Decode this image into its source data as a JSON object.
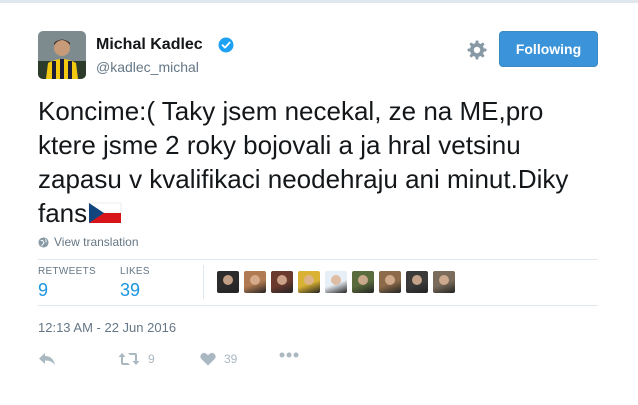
{
  "user": {
    "name": "Michal Kadlec",
    "handle": "@kadlec_michal",
    "verified": true
  },
  "follow_button": {
    "label": "Following"
  },
  "tweet": {
    "text": "Koncime:( Taky jsem necekal, ze na ME,pro ktere jsme 2 roky bojovali a ja hral vetsinu zapasu v kvalifikaci neodehraju ani minut.Diky fans",
    "emoji": "czech-flag"
  },
  "translate": {
    "label": "View translation"
  },
  "stats": {
    "retweets_label": "RETWEETS",
    "retweets_value": "9",
    "likes_label": "LIKES",
    "likes_value": "39"
  },
  "likers": [
    {
      "icon": "avatar-1",
      "color": "#2c2c2c"
    },
    {
      "icon": "avatar-2",
      "color": "#b07a52"
    },
    {
      "icon": "avatar-3",
      "color": "#6b3a2e"
    },
    {
      "icon": "avatar-4",
      "color": "#d9b233"
    },
    {
      "icon": "avatar-5",
      "color": "#e8eef5"
    },
    {
      "icon": "avatar-6",
      "color": "#5a6b3c"
    },
    {
      "icon": "avatar-7",
      "color": "#8c6a4a"
    },
    {
      "icon": "avatar-8",
      "color": "#3a3a3a"
    },
    {
      "icon": "avatar-9",
      "color": "#7a6b5a"
    }
  ],
  "timestamp": "12:13 AM - 22 Jun 2016",
  "actions": {
    "retweet_count": "9",
    "like_count": "39"
  },
  "colors": {
    "accent": "#1b95e0",
    "button": "#3b94d9",
    "muted": "#657786",
    "icon_muted": "#aab8c2"
  }
}
